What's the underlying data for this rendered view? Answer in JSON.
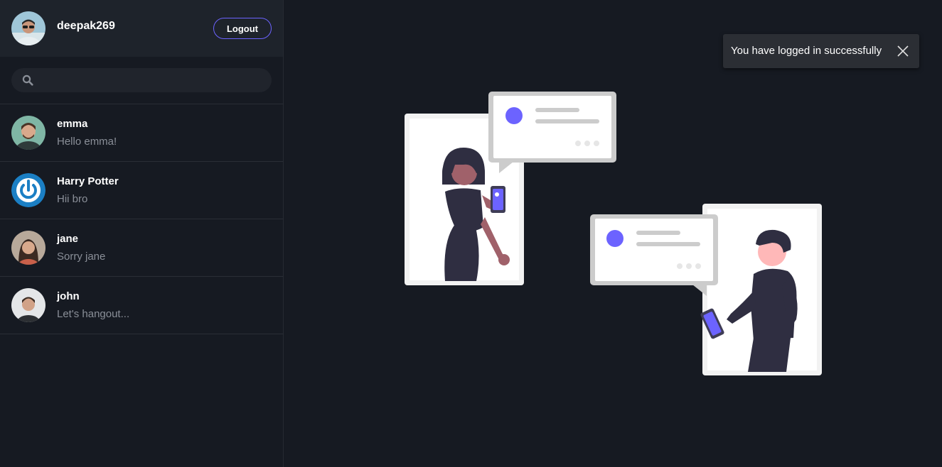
{
  "user": {
    "username": "deepak269",
    "logout_label": "Logout"
  },
  "search": {
    "placeholder": "",
    "value": ""
  },
  "contacts": [
    {
      "name": "emma",
      "last_message": "Hello emma!"
    },
    {
      "name": "Harry Potter",
      "last_message": "Hii bro"
    },
    {
      "name": "jane",
      "last_message": "Sorry jane"
    },
    {
      "name": "john",
      "last_message": "Let's hangout..."
    }
  ],
  "toast": {
    "message": "You have logged in successfully"
  },
  "colors": {
    "accent": "#6c63ff",
    "background": "#161a22",
    "panel": "#1e232b"
  }
}
